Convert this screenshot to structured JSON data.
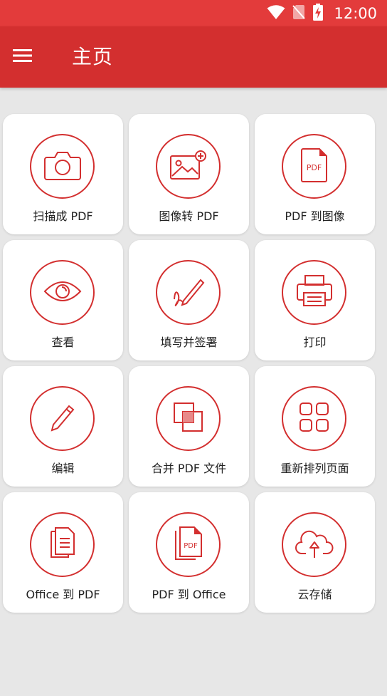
{
  "status_bar": {
    "time": "12:00",
    "icons": [
      "wifi-icon",
      "no-sim-icon",
      "battery-charging-icon"
    ]
  },
  "app_bar": {
    "menu_icon": "menu-icon",
    "title": "主页"
  },
  "colors": {
    "status_bar": "#e33b3b",
    "app_bar": "#d32f2f",
    "accent": "#d32f2f",
    "background": "#e7e7e7",
    "tile": "#ffffff"
  },
  "tiles": [
    {
      "label": "扫描成 PDF",
      "icon": "camera-icon"
    },
    {
      "label": "图像转 PDF",
      "icon": "image-add-icon"
    },
    {
      "label": "PDF 到图像",
      "icon": "pdf-file-icon"
    },
    {
      "label": "查看",
      "icon": "eye-icon"
    },
    {
      "label": "填写并签署",
      "icon": "pen-signature-icon"
    },
    {
      "label": "打印",
      "icon": "printer-icon"
    },
    {
      "label": "编辑",
      "icon": "pencil-icon"
    },
    {
      "label": "合并 PDF 文件",
      "icon": "merge-icon"
    },
    {
      "label": "重新排列页面",
      "icon": "grid-icon"
    },
    {
      "label": "Office 到 PDF",
      "icon": "document-stack-icon"
    },
    {
      "label": "PDF 到 Office",
      "icon": "pdf-stack-icon"
    },
    {
      "label": "云存储",
      "icon": "cloud-upload-icon"
    }
  ]
}
